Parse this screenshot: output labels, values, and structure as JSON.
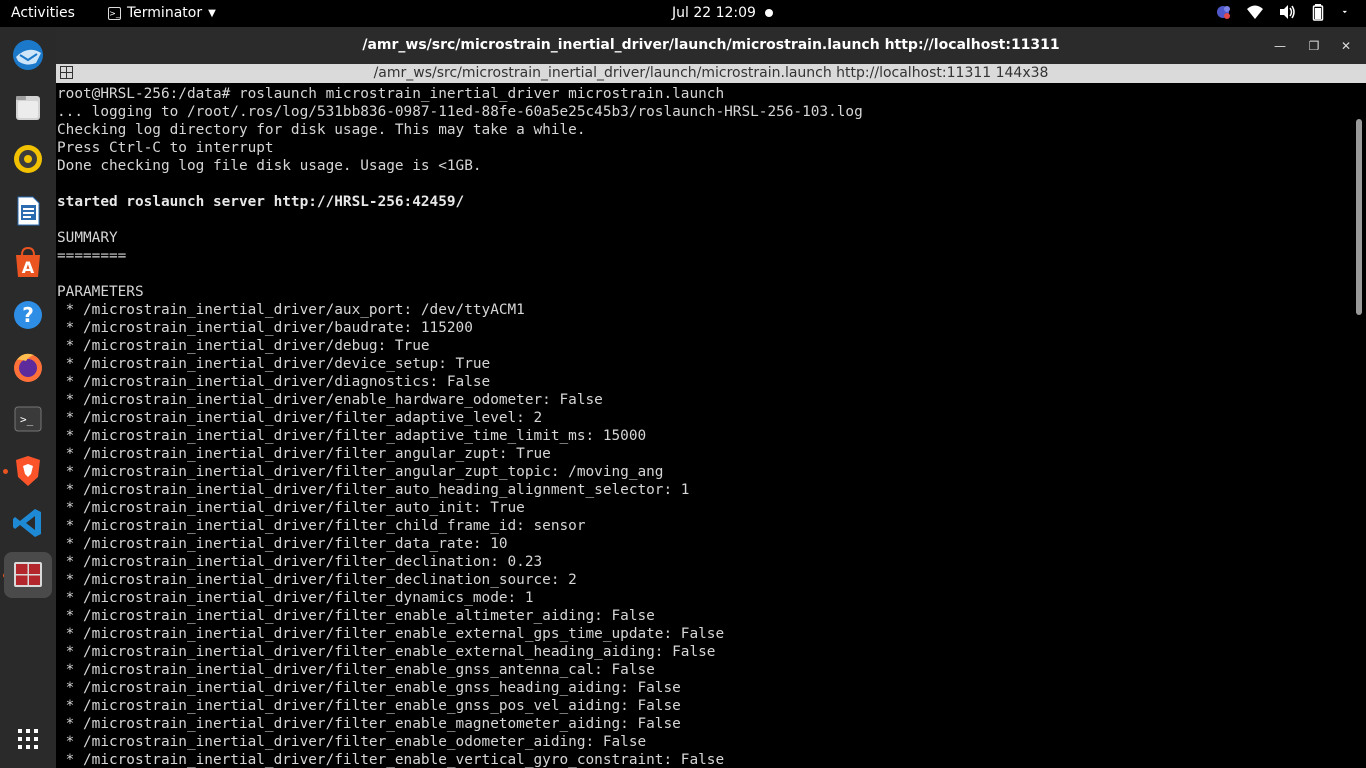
{
  "topbar": {
    "activities": "Activities",
    "app_name": "Terminator",
    "clock": "Jul 22  12:09"
  },
  "dock": {
    "items": [
      {
        "name": "thunderbird-icon"
      },
      {
        "name": "files-icon"
      },
      {
        "name": "rhythmbox-icon"
      },
      {
        "name": "libreoffice-writer-icon"
      },
      {
        "name": "ubuntu-software-icon"
      },
      {
        "name": "help-icon"
      },
      {
        "name": "firefox-icon"
      },
      {
        "name": "terminal-icon"
      },
      {
        "name": "brave-icon"
      },
      {
        "name": "vscode-icon"
      },
      {
        "name": "terminator-icon"
      },
      {
        "name": "show-apps-icon"
      }
    ]
  },
  "window": {
    "title": "/amr_ws/src/microstrain_inertial_driver/launch/microstrain.launch http://localhost:11311",
    "tab_title": "/amr_ws/src/microstrain_inertial_driver/launch/microstrain.launch http://localhost:11311 144x38"
  },
  "terminal": {
    "lines": [
      {
        "text": "root@HRSL-256:/data# roslaunch microstrain_inertial_driver microstrain.launch",
        "bold": false
      },
      {
        "text": "... logging to /root/.ros/log/531bb836-0987-11ed-88fe-60a5e25c45b3/roslaunch-HRSL-256-103.log",
        "bold": false
      },
      {
        "text": "Checking log directory for disk usage. This may take a while.",
        "bold": false
      },
      {
        "text": "Press Ctrl-C to interrupt",
        "bold": false
      },
      {
        "text": "Done checking log file disk usage. Usage is <1GB.",
        "bold": false
      },
      {
        "text": "",
        "bold": false
      },
      {
        "text": "started roslaunch server http://HRSL-256:42459/",
        "bold": true
      },
      {
        "text": "",
        "bold": false
      },
      {
        "text": "SUMMARY",
        "bold": false
      },
      {
        "text": "========",
        "bold": false
      },
      {
        "text": "",
        "bold": false
      },
      {
        "text": "PARAMETERS",
        "bold": false
      },
      {
        "text": " * /microstrain_inertial_driver/aux_port: /dev/ttyACM1",
        "bold": false
      },
      {
        "text": " * /microstrain_inertial_driver/baudrate: 115200",
        "bold": false
      },
      {
        "text": " * /microstrain_inertial_driver/debug: True",
        "bold": false
      },
      {
        "text": " * /microstrain_inertial_driver/device_setup: True",
        "bold": false
      },
      {
        "text": " * /microstrain_inertial_driver/diagnostics: False",
        "bold": false
      },
      {
        "text": " * /microstrain_inertial_driver/enable_hardware_odometer: False",
        "bold": false
      },
      {
        "text": " * /microstrain_inertial_driver/filter_adaptive_level: 2",
        "bold": false
      },
      {
        "text": " * /microstrain_inertial_driver/filter_adaptive_time_limit_ms: 15000",
        "bold": false
      },
      {
        "text": " * /microstrain_inertial_driver/filter_angular_zupt: True",
        "bold": false
      },
      {
        "text": " * /microstrain_inertial_driver/filter_angular_zupt_topic: /moving_ang",
        "bold": false
      },
      {
        "text": " * /microstrain_inertial_driver/filter_auto_heading_alignment_selector: 1",
        "bold": false
      },
      {
        "text": " * /microstrain_inertial_driver/filter_auto_init: True",
        "bold": false
      },
      {
        "text": " * /microstrain_inertial_driver/filter_child_frame_id: sensor",
        "bold": false
      },
      {
        "text": " * /microstrain_inertial_driver/filter_data_rate: 10",
        "bold": false
      },
      {
        "text": " * /microstrain_inertial_driver/filter_declination: 0.23",
        "bold": false
      },
      {
        "text": " * /microstrain_inertial_driver/filter_declination_source: 2",
        "bold": false
      },
      {
        "text": " * /microstrain_inertial_driver/filter_dynamics_mode: 1",
        "bold": false
      },
      {
        "text": " * /microstrain_inertial_driver/filter_enable_altimeter_aiding: False",
        "bold": false
      },
      {
        "text": " * /microstrain_inertial_driver/filter_enable_external_gps_time_update: False",
        "bold": false
      },
      {
        "text": " * /microstrain_inertial_driver/filter_enable_external_heading_aiding: False",
        "bold": false
      },
      {
        "text": " * /microstrain_inertial_driver/filter_enable_gnss_antenna_cal: False",
        "bold": false
      },
      {
        "text": " * /microstrain_inertial_driver/filter_enable_gnss_heading_aiding: False",
        "bold": false
      },
      {
        "text": " * /microstrain_inertial_driver/filter_enable_gnss_pos_vel_aiding: False",
        "bold": false
      },
      {
        "text": " * /microstrain_inertial_driver/filter_enable_magnetometer_aiding: False",
        "bold": false
      },
      {
        "text": " * /microstrain_inertial_driver/filter_enable_odometer_aiding: False",
        "bold": false
      },
      {
        "text": " * /microstrain_inertial_driver/filter_enable_vertical_gyro_constraint: False",
        "bold": false
      }
    ]
  }
}
